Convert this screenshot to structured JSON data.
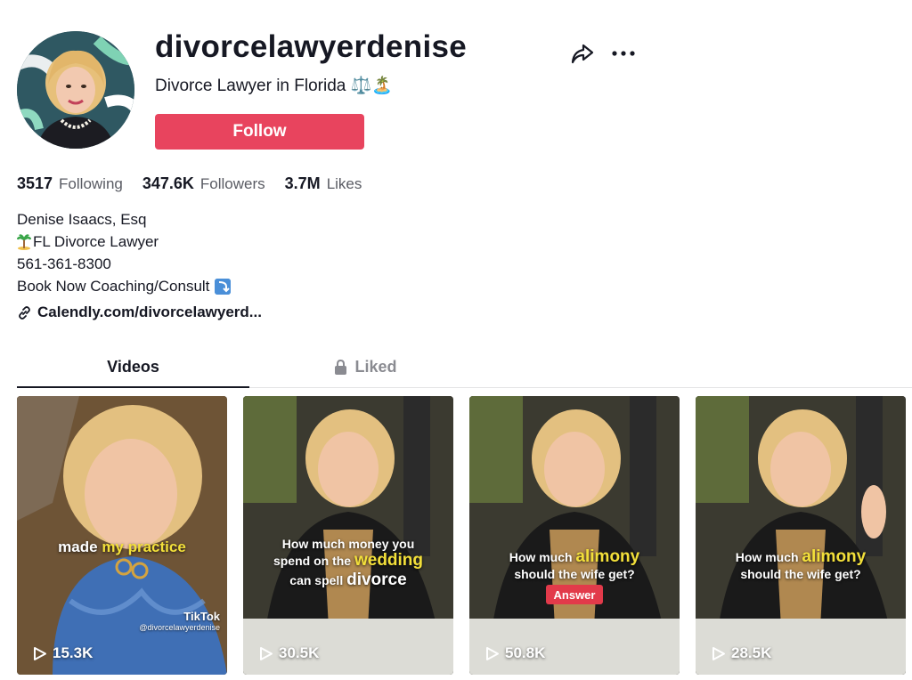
{
  "profile": {
    "username": "divorcelawyerdenise",
    "subtitle": "Divorce Lawyer in Florida ⚖️🏝️",
    "follow_label": "Follow"
  },
  "stats": [
    {
      "value": "3517",
      "label": "Following"
    },
    {
      "value": "347.6K",
      "label": "Followers"
    },
    {
      "value": "3.7M",
      "label": "Likes"
    }
  ],
  "bio": {
    "line1": "Denise Isaacs, Esq",
    "line2": "FL Divorce Lawyer",
    "line3": "561-361-8300",
    "line4": "Book Now Coaching/Consult"
  },
  "link": {
    "text": "Calendly.com/divorcelawyerd..."
  },
  "tabs": {
    "videos": "Videos",
    "liked": "Liked"
  },
  "videos": [
    {
      "views": "15.3K",
      "caption_a": "made ",
      "caption_hl": "my practice",
      "watermark": "TikTok",
      "handle": "@divorcelawyerdenise"
    },
    {
      "views": "30.5K",
      "caption_l1": "How much money you",
      "caption_l2a": "spend on the ",
      "caption_l2hl": "wedding",
      "caption_l3a": "can spell ",
      "caption_l3b": "divorce"
    },
    {
      "views": "50.8K",
      "caption_l1a": "How much ",
      "caption_l1hl": "alimony",
      "caption_l2": "should the wife get?",
      "answer": "Answer"
    },
    {
      "views": "28.5K",
      "caption_l1a": "How much ",
      "caption_l1hl": "alimony",
      "caption_l2": "should the wife get?"
    }
  ],
  "colors": {
    "follow": "#e8445e",
    "highlight": "#f3e03a",
    "text": "#161823",
    "muted": "#595b63"
  },
  "icons": [
    "share-icon",
    "more-icon",
    "link-icon",
    "lock-icon",
    "play-icon"
  ]
}
